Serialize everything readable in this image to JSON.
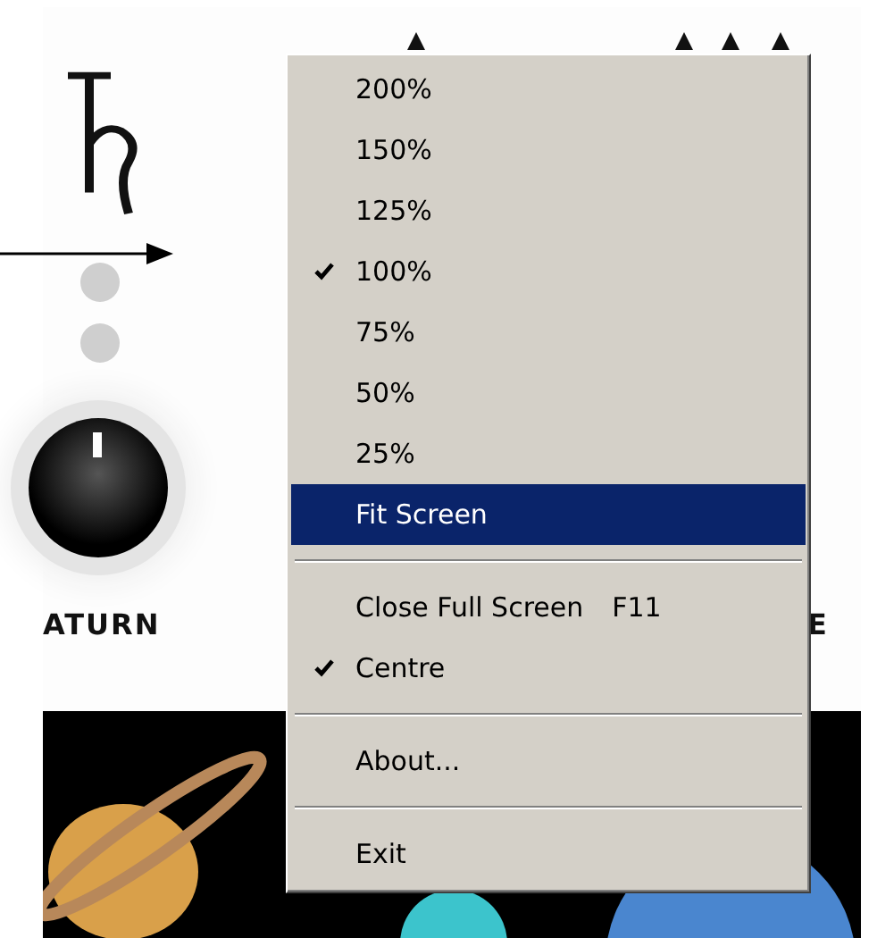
{
  "background": {
    "planet_label": "ATURN",
    "edge_letter": "E"
  },
  "menu": {
    "items": [
      {
        "kind": "item",
        "label": "200%",
        "checked": false,
        "selected": false
      },
      {
        "kind": "item",
        "label": "150%",
        "checked": false,
        "selected": false
      },
      {
        "kind": "item",
        "label": "125%",
        "checked": false,
        "selected": false
      },
      {
        "kind": "item",
        "label": "100%",
        "checked": true,
        "selected": false
      },
      {
        "kind": "item",
        "label": "75%",
        "checked": false,
        "selected": false
      },
      {
        "kind": "item",
        "label": "50%",
        "checked": false,
        "selected": false
      },
      {
        "kind": "item",
        "label": "25%",
        "checked": false,
        "selected": false
      },
      {
        "kind": "item",
        "label": "Fit Screen",
        "checked": false,
        "selected": true
      },
      {
        "kind": "separator"
      },
      {
        "kind": "item",
        "label": "Close Full Screen",
        "shortcut": "F11",
        "checked": false,
        "selected": false
      },
      {
        "kind": "item",
        "label": "Centre",
        "checked": true,
        "selected": false
      },
      {
        "kind": "separator"
      },
      {
        "kind": "item",
        "label": "About...",
        "checked": false,
        "selected": false
      },
      {
        "kind": "separator"
      },
      {
        "kind": "item",
        "label": "Exit",
        "checked": false,
        "selected": false
      }
    ]
  }
}
